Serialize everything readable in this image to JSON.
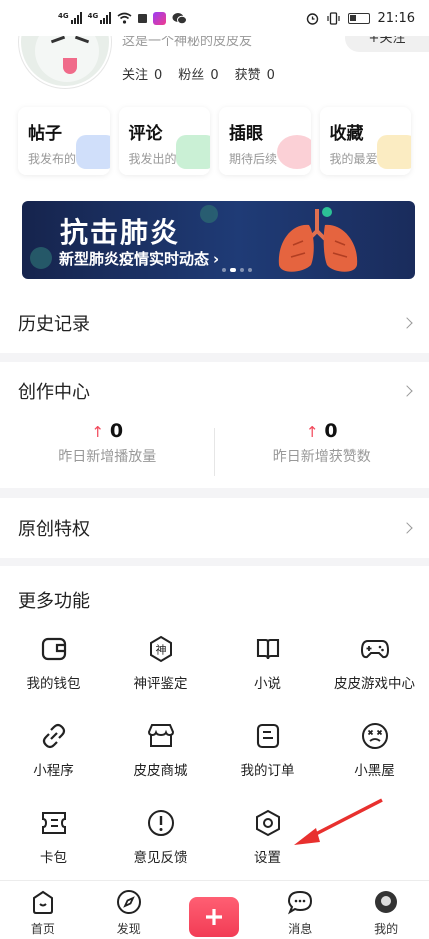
{
  "status_bar": {
    "time": "21:16",
    "network": "4G"
  },
  "profile": {
    "bio": "这是一个神秘的皮皮友",
    "follow_button": "+关注",
    "stats": [
      {
        "label": "关注",
        "value": "0"
      },
      {
        "label": "粉丝",
        "value": "0"
      },
      {
        "label": "获赞",
        "value": "0"
      }
    ]
  },
  "quick_cards": [
    {
      "title": "帖子",
      "subtitle": "我发布的",
      "accent": "#a9c4f5"
    },
    {
      "title": "评论",
      "subtitle": "我发出的",
      "accent": "#9fe3b3"
    },
    {
      "title": "插眼",
      "subtitle": "期待后续",
      "accent": "#f7a9b4"
    },
    {
      "title": "收藏",
      "subtitle": "我的最爱",
      "accent": "#f8dc8f"
    }
  ],
  "banner": {
    "title": "抗击肺炎",
    "subtitle": "新型肺炎疫情实时动态",
    "arrow": "›"
  },
  "rows": {
    "history": "历史记录",
    "creator": "创作中心",
    "original": "原创特权"
  },
  "creator_stats": [
    {
      "value": "0",
      "label": "昨日新增播放量"
    },
    {
      "value": "0",
      "label": "昨日新增获赞数"
    }
  ],
  "more": {
    "title": "更多功能",
    "items": [
      {
        "label": "我的钱包",
        "icon": "wallet-icon"
      },
      {
        "label": "神评鉴定",
        "icon": "shen-badge-icon"
      },
      {
        "label": "小说",
        "icon": "book-icon"
      },
      {
        "label": "皮皮游戏中心",
        "icon": "gamepad-icon"
      },
      {
        "label": "小程序",
        "icon": "link-icon"
      },
      {
        "label": "皮皮商城",
        "icon": "store-icon"
      },
      {
        "label": "我的订单",
        "icon": "order-icon"
      },
      {
        "label": "小黑屋",
        "icon": "dizzy-face-icon"
      },
      {
        "label": "卡包",
        "icon": "card-icon"
      },
      {
        "label": "意见反馈",
        "icon": "feedback-icon"
      },
      {
        "label": "设置",
        "icon": "settings-hex-icon"
      }
    ]
  },
  "tabs": [
    {
      "label": "首页"
    },
    {
      "label": "发现"
    },
    {
      "label": ""
    },
    {
      "label": "消息"
    },
    {
      "label": "我的"
    }
  ],
  "colors": {
    "accent": "#f23c55",
    "banner_bg": "#1f3b76"
  }
}
